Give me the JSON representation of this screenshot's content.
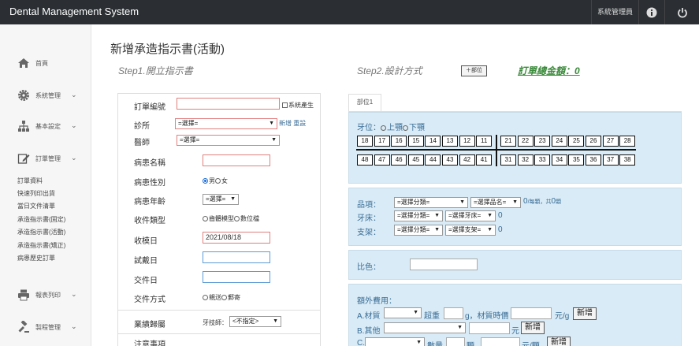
{
  "app": {
    "title": "Dental Management System",
    "user_label": "系統管理員"
  },
  "sidebar": {
    "home": "首頁",
    "system": "系統管理",
    "basic": "基本設定",
    "orders": "訂單管理",
    "order_sub": [
      "訂單資料",
      "快速列印出貨",
      "當日文件清單",
      "承造指示書(固定)",
      "承造指示書(活動)",
      "承造指示書(矯正)",
      "病患歷史訂單"
    ],
    "report": "報表列印",
    "process": "製程管理"
  },
  "page": {
    "title": "新增承造指示書(活動)",
    "step1": "Step1.開立指示書",
    "step2": "Step2.設計方式",
    "add_part": "＋部位",
    "total": "訂單總金額：0"
  },
  "form": {
    "order_no_label": "訂單編號",
    "order_no_value": "",
    "auto_label": "系統產生",
    "clinic_label": "診所",
    "clinic_select": "=選擇=",
    "clinic_links": "新增 重設",
    "doctor_label": "醫師",
    "doctor_select": "=選擇=",
    "patient_name_label": "病患名稱",
    "patient_name_value": "",
    "gender_label": "病患性別",
    "gender_male": "男",
    "gender_female": "女",
    "age_label": "病患年齡",
    "age_select": "=選擇=",
    "receive_type_label": "收件類型",
    "receive_type_options": [
      "齒體模型",
      "數位檔"
    ],
    "receive_date_label": "收模日",
    "receive_date_value": "2021/08/18",
    "tryin_date_label": "試戴日",
    "tryin_date_value": "",
    "delivery_date_label": "交件日",
    "delivery_date_value": "",
    "delivery_method_label": "交件方式",
    "delivery_methods": [
      "親送",
      "郵寄"
    ],
    "business_label": "業績歸屬",
    "tech_label": "牙技師：",
    "tech_select": "<不指定>",
    "notes_label": "注意事項"
  },
  "design": {
    "tab": "部位1",
    "tooth_label": "牙位：",
    "upper_label": "上顎",
    "lower_label": "下顎",
    "upper_right": [
      "18",
      "17",
      "16",
      "15",
      "14",
      "13",
      "12",
      "11"
    ],
    "upper_left": [
      "21",
      "22",
      "23",
      "24",
      "25",
      "26",
      "27",
      "28"
    ],
    "lower_right": [
      "48",
      "47",
      "46",
      "45",
      "44",
      "43",
      "42",
      "41"
    ],
    "lower_left": [
      "31",
      "32",
      "33",
      "34",
      "35",
      "36",
      "37",
      "38"
    ],
    "product_label": "品項：",
    "product_cat": "=選擇分類=",
    "product_name": "=選擇品名=",
    "product_count": "0",
    "product_unit": "/每顆，共",
    "product_total": "0",
    "product_unit2": "顆",
    "bed_label": "牙床：",
    "bed_cat": "=選擇分類=",
    "bed_select": "=選擇牙床=",
    "bed_count": "0",
    "frame_label": "支架：",
    "frame_cat": "=選擇分類=",
    "frame_select": "=選擇支架=",
    "frame_count": "0",
    "color_label": "比色：",
    "color_value": "",
    "extra_label": "額外費用：",
    "extra_a": "A.材質",
    "extra_a_weight": "超重",
    "extra_a_unit": "g，材質時價",
    "extra_a_price_unit": "元/g",
    "extra_b": "B.其他",
    "extra_b_unit": "元",
    "extra_c": "C.",
    "extra_c_qty": "數量",
    "extra_c_unit": "顆，",
    "extra_c_price_unit": "元/顆",
    "add_btn": "新增"
  }
}
